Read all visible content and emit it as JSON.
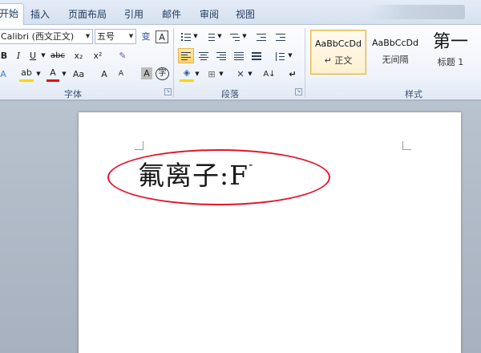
{
  "tabs": [
    "开始",
    "插入",
    "页面布局",
    "引用",
    "邮件",
    "审阅",
    "视图"
  ],
  "font": {
    "name_value": "Calibri (西文正文)",
    "size_value": "五号",
    "phonetic_glyph": "变",
    "border_glyph": "A",
    "bold": "B",
    "italic": "I",
    "underline": "U",
    "strike": "abc",
    "subscript": "x₂",
    "superscript": "x²",
    "clear_glyph": "🔖",
    "text_effect": "A",
    "highlight": "ab",
    "font_color": "A",
    "change_case": "Aa",
    "grow": "A",
    "shrink": "A",
    "char_shading": "A",
    "enclose": "字",
    "group_label": "字体"
  },
  "paragraph": {
    "group_label": "段落",
    "sort_glyph": "A↓",
    "marks_glyph": "↵"
  },
  "styles": {
    "group_label": "样式",
    "items": [
      {
        "sample": "AaBbCcDd",
        "name": "↵ 正文"
      },
      {
        "sample": "AaBbCcDd",
        "name": "无间隔"
      },
      {
        "sample": "第一",
        "name": "标题 1"
      }
    ]
  },
  "document": {
    "text": "氟离子:F",
    "superscript": "-"
  },
  "colors": {
    "accent_red": "#e3132b",
    "highlight_yellow": "#ffd400",
    "font_color_red": "#e01010"
  }
}
